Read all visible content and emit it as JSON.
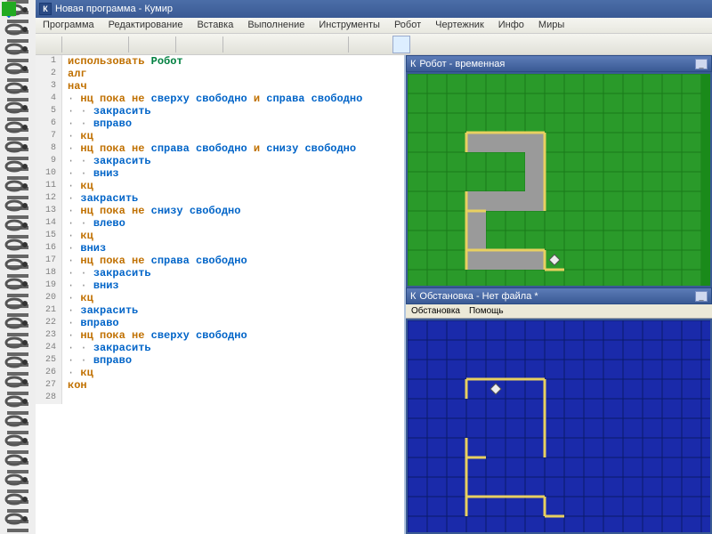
{
  "app": {
    "icon": "К",
    "title": "Новая программа - Кумир"
  },
  "menu": [
    "Программа",
    "Редактирование",
    "Вставка",
    "Выполнение",
    "Инструменты",
    "Робот",
    "Чертежник",
    "Инфо",
    "Миры"
  ],
  "toolbar_icons": [
    "save",
    "cut",
    "copy",
    "paste",
    "undo",
    "redo",
    "indent-left",
    "indent-right",
    "run-start",
    "step-into",
    "step-over",
    "step-out",
    "stop",
    "cancel",
    "grid-green",
    "grid-split",
    "grid-full"
  ],
  "code": [
    {
      "n": 1,
      "tokens": [
        {
          "t": "использовать ",
          "c": "kw"
        },
        {
          "t": "Робот",
          "c": "cl"
        }
      ]
    },
    {
      "n": 2,
      "tokens": [
        {
          "t": "алг",
          "c": "kw"
        }
      ]
    },
    {
      "n": 3,
      "tokens": [
        {
          "t": "нач",
          "c": "kw"
        }
      ]
    },
    {
      "n": 4,
      "tokens": [
        {
          "t": "·",
          "c": "dot"
        },
        {
          "t": " нц пока не ",
          "c": "kw"
        },
        {
          "t": "сверху свободно",
          "c": "fn"
        },
        {
          "t": " и ",
          "c": "kw"
        },
        {
          "t": "справа свободно",
          "c": "fn"
        }
      ]
    },
    {
      "n": 5,
      "tokens": [
        {
          "t": "· · ",
          "c": "dot"
        },
        {
          "t": "закрасить",
          "c": "fn"
        }
      ]
    },
    {
      "n": 6,
      "tokens": [
        {
          "t": "· · ",
          "c": "dot"
        },
        {
          "t": "вправо",
          "c": "fn"
        }
      ]
    },
    {
      "n": 7,
      "tokens": [
        {
          "t": "·",
          "c": "dot"
        },
        {
          "t": " кц",
          "c": "kw"
        }
      ]
    },
    {
      "n": 8,
      "tokens": [
        {
          "t": "·",
          "c": "dot"
        },
        {
          "t": " нц пока не ",
          "c": "kw"
        },
        {
          "t": "справа свободно",
          "c": "fn"
        },
        {
          "t": " и ",
          "c": "kw"
        },
        {
          "t": "снизу свободно",
          "c": "fn"
        }
      ]
    },
    {
      "n": 9,
      "tokens": [
        {
          "t": "· · ",
          "c": "dot"
        },
        {
          "t": "закрасить",
          "c": "fn"
        }
      ]
    },
    {
      "n": 10,
      "tokens": [
        {
          "t": "· · ",
          "c": "dot"
        },
        {
          "t": "вниз",
          "c": "fn"
        }
      ]
    },
    {
      "n": 11,
      "tokens": [
        {
          "t": "·",
          "c": "dot"
        },
        {
          "t": " кц",
          "c": "kw"
        }
      ]
    },
    {
      "n": 12,
      "tokens": [
        {
          "t": "·",
          "c": "dot"
        },
        {
          "t": " закрасить",
          "c": "fn"
        }
      ]
    },
    {
      "n": 13,
      "tokens": [
        {
          "t": "·",
          "c": "dot"
        },
        {
          "t": " нц пока не ",
          "c": "kw"
        },
        {
          "t": "снизу свободно",
          "c": "fn"
        }
      ]
    },
    {
      "n": 14,
      "tokens": [
        {
          "t": "· · ",
          "c": "dot"
        },
        {
          "t": "влево",
          "c": "fn"
        }
      ]
    },
    {
      "n": 15,
      "tokens": [
        {
          "t": "·",
          "c": "dot"
        },
        {
          "t": " кц",
          "c": "kw"
        }
      ]
    },
    {
      "n": 16,
      "tokens": [
        {
          "t": "·",
          "c": "dot"
        },
        {
          "t": " вниз",
          "c": "fn"
        }
      ]
    },
    {
      "n": 17,
      "tokens": [
        {
          "t": "·",
          "c": "dot"
        },
        {
          "t": " нц пока не ",
          "c": "kw"
        },
        {
          "t": "справа свободно",
          "c": "fn"
        }
      ]
    },
    {
      "n": 18,
      "tokens": [
        {
          "t": "· · ",
          "c": "dot"
        },
        {
          "t": "закрасить",
          "c": "fn"
        }
      ]
    },
    {
      "n": 19,
      "tokens": [
        {
          "t": "· · ",
          "c": "dot"
        },
        {
          "t": "вниз",
          "c": "fn"
        }
      ]
    },
    {
      "n": 20,
      "tokens": [
        {
          "t": "·",
          "c": "dot"
        },
        {
          "t": " кц",
          "c": "kw"
        }
      ]
    },
    {
      "n": 21,
      "tokens": [
        {
          "t": "·",
          "c": "dot"
        },
        {
          "t": " закрасить",
          "c": "fn"
        }
      ]
    },
    {
      "n": 22,
      "tokens": [
        {
          "t": "·",
          "c": "dot"
        },
        {
          "t": " вправо",
          "c": "fn"
        }
      ]
    },
    {
      "n": 23,
      "tokens": [
        {
          "t": "·",
          "c": "dot"
        },
        {
          "t": " нц пока не ",
          "c": "kw"
        },
        {
          "t": "сверху свободно",
          "c": "fn"
        }
      ]
    },
    {
      "n": 24,
      "tokens": [
        {
          "t": "· · ",
          "c": "dot"
        },
        {
          "t": "закрасить",
          "c": "fn"
        }
      ]
    },
    {
      "n": 25,
      "tokens": [
        {
          "t": "· · ",
          "c": "dot"
        },
        {
          "t": "вправо",
          "c": "fn"
        }
      ]
    },
    {
      "n": 26,
      "tokens": [
        {
          "t": "·",
          "c": "dot"
        },
        {
          "t": " кц",
          "c": "kw"
        }
      ]
    },
    {
      "n": 27,
      "tokens": [
        {
          "t": "кон",
          "c": "kw"
        }
      ]
    },
    {
      "n": 28,
      "tokens": []
    }
  ],
  "robot_panel": {
    "title": "Робот - временная",
    "icon": "К",
    "grid": {
      "cols": 15,
      "rows": 11,
      "cell": 22,
      "painted": [
        [
          3,
          3
        ],
        [
          4,
          3
        ],
        [
          5,
          3
        ],
        [
          6,
          3
        ],
        [
          6,
          4
        ],
        [
          6,
          5
        ],
        [
          6,
          6
        ],
        [
          5,
          6
        ],
        [
          4,
          6
        ],
        [
          3,
          6
        ],
        [
          3,
          7
        ],
        [
          3,
          8
        ],
        [
          3,
          9
        ],
        [
          4,
          9
        ],
        [
          5,
          9
        ],
        [
          6,
          9
        ]
      ],
      "walls_h": [
        [
          3,
          3,
          7
        ],
        [
          7,
          4,
          7
        ],
        [
          3,
          7,
          4
        ],
        [
          3,
          9,
          7
        ],
        [
          7,
          10,
          8
        ]
      ],
      "walls_v": [
        [
          3,
          3,
          4
        ],
        [
          7,
          3,
          7
        ],
        [
          3,
          6,
          10
        ],
        [
          7,
          9,
          10
        ]
      ],
      "robot": [
        7,
        9
      ]
    }
  },
  "obst_panel": {
    "title": "Обстановка - Нет файла *",
    "icon": "К",
    "submenu": [
      "Обстановка",
      "Помощь"
    ],
    "grid": {
      "cols": 16,
      "rows": 11,
      "cell": 22,
      "walls_h": [
        [
          3,
          3,
          7
        ],
        [
          7,
          4,
          7
        ],
        [
          3,
          7,
          4
        ],
        [
          3,
          9,
          7
        ],
        [
          7,
          10,
          8
        ]
      ],
      "walls_v": [
        [
          3,
          3,
          4
        ],
        [
          7,
          3,
          7
        ],
        [
          3,
          6,
          10
        ],
        [
          7,
          9,
          10
        ]
      ],
      "robot": [
        4,
        3
      ]
    }
  }
}
